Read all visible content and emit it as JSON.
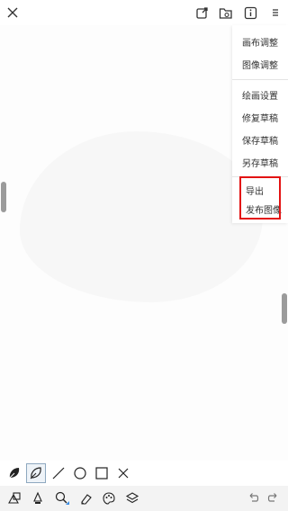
{
  "top_bar": {
    "icons": [
      "close-icon",
      "export-share-icon",
      "open-folder-icon",
      "info-icon",
      "more-menu-icon"
    ]
  },
  "menu": {
    "items": [
      {
        "label": "画布调整"
      },
      {
        "label": "图像调整"
      },
      {
        "label": "绘画设置"
      },
      {
        "label": "修复草稿"
      },
      {
        "label": "保存草稿"
      },
      {
        "label": "另存草稿"
      },
      {
        "label": "导出"
      },
      {
        "label": "发布图像"
      }
    ],
    "highlight_color": "#e31313"
  },
  "tools": {
    "shapes": [
      "filled-lasso-icon",
      "lasso-icon",
      "line-icon",
      "circle-icon",
      "square-icon",
      "cross-icon"
    ],
    "bottom": [
      "shapes-icon",
      "pen-icon",
      "select-pen-icon",
      "eraser-icon",
      "palette-icon",
      "layers-icon",
      "undo-icon",
      "redo-icon"
    ],
    "selected": "lasso-icon"
  }
}
